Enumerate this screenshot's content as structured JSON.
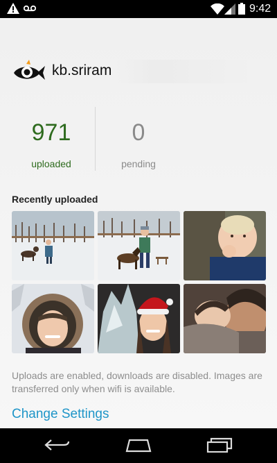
{
  "status_bar": {
    "time": "9:42",
    "icons": [
      "warning-icon",
      "voicemail-icon",
      "wifi-icon",
      "signal-icon",
      "battery-icon"
    ]
  },
  "account": {
    "username": "kb.sriram",
    "logo_icon": "fish-eye-logo"
  },
  "stats": {
    "uploaded": {
      "value": "971",
      "label": "uploaded"
    },
    "pending": {
      "value": "0",
      "label": "pending"
    }
  },
  "recent": {
    "title": "Recently uploaded",
    "photos": [
      {
        "name": "photo-dog-snow-1",
        "subject": "man with dog in snow"
      },
      {
        "name": "photo-dog-snow-2",
        "subject": "child with dog in snow"
      },
      {
        "name": "photo-baby",
        "subject": "baby with hand to mouth"
      },
      {
        "name": "photo-fur-hood",
        "subject": "smiling woman in fur hood"
      },
      {
        "name": "photo-santa-hat",
        "subject": "woman in santa hat by ice sculpture"
      },
      {
        "name": "photo-father-baby",
        "subject": "father with sleeping baby"
      }
    ]
  },
  "note": "Uploads are enabled, downloads are disabled. Images are transferred only when wifi is available.",
  "change_settings_label": "Change Settings",
  "nav": [
    "back-icon",
    "home-icon",
    "recents-icon"
  ],
  "colors": {
    "uploaded": "#2e6b1e",
    "pending": "#8a8a8a",
    "link": "#1e95c8",
    "logo_accent": "#f39c1a"
  }
}
